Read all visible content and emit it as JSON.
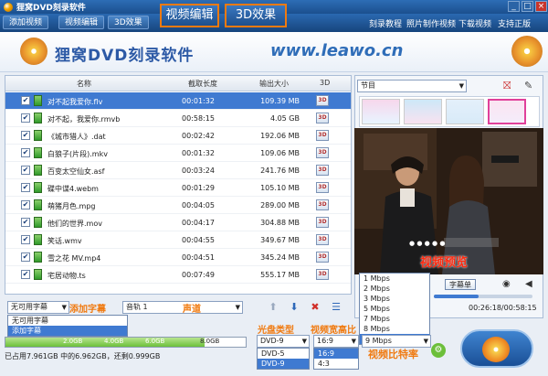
{
  "window": {
    "title": "狸窝DVD刻录软件",
    "controls": [
      "_",
      "□",
      "×"
    ]
  },
  "nav": {
    "add_video": "添加视频",
    "video_edit": "视频编辑",
    "effect_3d": "3D效果",
    "callout_edit": "视频编辑",
    "callout_3d": "3D效果",
    "links": [
      "刻录教程",
      "照片制作视频",
      "下载视频",
      "支持正版"
    ]
  },
  "banner": {
    "brand": "狸窝DVD刻录软件",
    "url": "www.leawo.cn"
  },
  "list": {
    "columns": [
      "名称",
      "截取长度",
      "输出大小",
      "3D"
    ],
    "rows": [
      {
        "name": "对不起我爱你.flv",
        "duration": "00:01:32",
        "size": "109.39 MB",
        "selected": true
      },
      {
        "name": "对不起，我爱你.rmvb",
        "duration": "00:58:15",
        "size": "4.05 GB",
        "selected": false
      },
      {
        "name": "《城市猎人》.dat",
        "duration": "00:02:42",
        "size": "192.06 MB",
        "selected": false
      },
      {
        "name": "白狼子(片段).mkv",
        "duration": "00:01:32",
        "size": "109.06 MB",
        "selected": false
      },
      {
        "name": "百变太空仙女.asf",
        "duration": "00:03:24",
        "size": "241.76 MB",
        "selected": false
      },
      {
        "name": "碟中谍4.webm",
        "duration": "00:01:29",
        "size": "105.10 MB",
        "selected": false
      },
      {
        "name": "萌猪月色.mpg",
        "duration": "00:04:05",
        "size": "289.00 MB",
        "selected": false
      },
      {
        "name": "他们的世界.mov",
        "duration": "00:04:17",
        "size": "304.88 MB",
        "selected": false
      },
      {
        "name": "笑话.wmv",
        "duration": "00:04:55",
        "size": "349.67 MB",
        "selected": false
      },
      {
        "name": "雪之花 MV.mp4",
        "duration": "00:04:51",
        "size": "345.24 MB",
        "selected": false
      },
      {
        "name": "宅居动物.ts",
        "duration": "00:07:49",
        "size": "555.17 MB",
        "selected": false
      }
    ],
    "badge_3d": "3D"
  },
  "tools": {
    "subtitle_value": "无可用字幕",
    "subtitle_callout": "添加字幕",
    "subtitle_options": [
      "无可用字幕",
      "添加字幕"
    ],
    "audio_value": "音轨 1",
    "audio_callout": "声道"
  },
  "preview": {
    "chapter_label": "节目",
    "caption": "视频预览",
    "subtitle_btn": "字幕单",
    "time": "00:26:18/00:58:15",
    "bitrate_options": [
      "1 Mbps",
      "2 Mbps",
      "3 Mbps",
      "5 Mbps",
      "7 Mbps",
      "8 Mbps",
      "9 Mbps"
    ],
    "bitrate_selected": "9 Mbps"
  },
  "output": {
    "disc_type": "DVD-9",
    "disc_options": [
      "DVD-5",
      "DVD-9"
    ],
    "aspect": "16:9",
    "aspect_options": [
      "16:9",
      "4:3"
    ],
    "bitrate": "9 Mbps",
    "callout_disc": "光盘类型",
    "callout_aspect": "视频宽高比",
    "callout_bitrate": "视频比特率"
  },
  "capacity": {
    "marks": [
      "2.0GB",
      "4.0GB",
      "6.0GB",
      "8.0GB"
    ],
    "used_fraction": 0.83,
    "status": "已占用7.961GB 中的6.962GB，还剩0.999GB"
  },
  "colors": {
    "accent": "#f07a10",
    "nav": "#1d5296",
    "selected_row": "#3f7ad1"
  }
}
